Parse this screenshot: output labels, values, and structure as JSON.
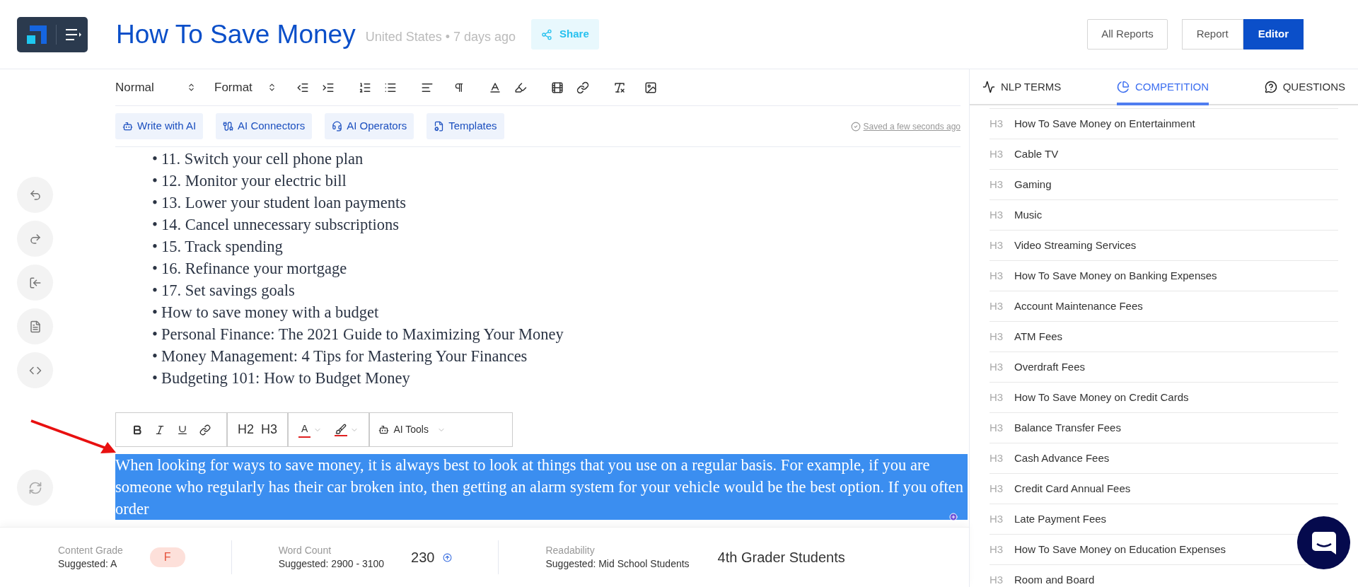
{
  "header": {
    "title": "How To Save Money",
    "location": "United States",
    "separator": "•",
    "age": "7 days ago",
    "share": "Share"
  },
  "nav_buttons": [
    {
      "label": "All Reports"
    }
  ],
  "view_toggle": [
    {
      "label": "Report",
      "selected": false
    },
    {
      "label": "Editor",
      "selected": true
    }
  ],
  "toolbar": {
    "style_select": "Normal",
    "format_select": "Format"
  },
  "ai_buttons": [
    "Write with AI",
    "AI Connectors",
    "AI Operators",
    "Templates"
  ],
  "save_status": "Saved a few seconds ago",
  "content": {
    "bullet": "•",
    "list": [
      "11. Switch your cell phone plan",
      "12. Monitor your electric bill",
      "13. Lower your student loan payments",
      "14. Cancel unnecessary subscriptions",
      "15. Track spending",
      "16. Refinance your mortgage",
      "17. Set savings goals",
      "How to save money with a budget",
      "Personal Finance: The 2021 Guide to Maximizing Your Money",
      "Money Management: 4 Tips for Mastering Your Finances",
      "Budgeting 101: How to Budget Money"
    ],
    "selected_paragraph": "When looking for ways to save money, it is always best to look at things that you use on a regular basis. For example, if you are someone who regularly has their car broken into, then getting an alarm system for your vehicle would be the best option. If you often order"
  },
  "bubble_toolbar": {
    "headings": [
      "H2",
      "H3"
    ],
    "text_color": "A",
    "ai_tools": "AI Tools"
  },
  "tabs": [
    {
      "label": "NLP TERMS",
      "selected": false
    },
    {
      "label": "COMPETITION",
      "selected": true
    },
    {
      "label": "QUESTIONS",
      "selected": false
    }
  ],
  "headings": [
    {
      "level": "H3",
      "text": "How To Save Money on Entertainment"
    },
    {
      "level": "H3",
      "text": "Cable TV"
    },
    {
      "level": "H3",
      "text": "Gaming"
    },
    {
      "level": "H3",
      "text": "Music"
    },
    {
      "level": "H3",
      "text": "Video Streaming Services"
    },
    {
      "level": "H3",
      "text": "How To Save Money on Banking Expenses"
    },
    {
      "level": "H3",
      "text": "Account Maintenance Fees"
    },
    {
      "level": "H3",
      "text": "ATM Fees"
    },
    {
      "level": "H3",
      "text": "Overdraft Fees"
    },
    {
      "level": "H3",
      "text": "How To Save Money on Credit Cards"
    },
    {
      "level": "H3",
      "text": "Balance Transfer Fees"
    },
    {
      "level": "H3",
      "text": "Cash Advance Fees"
    },
    {
      "level": "H3",
      "text": "Credit Card Annual Fees"
    },
    {
      "level": "H3",
      "text": "Late Payment Fees"
    },
    {
      "level": "H3",
      "text": "How To Save Money on Education Expenses"
    },
    {
      "level": "H3",
      "text": "Room and Board"
    }
  ],
  "metrics": [
    {
      "kind": "grade",
      "label": "Content Grade",
      "suggested": "Suggested: A",
      "value": "F"
    },
    {
      "kind": "count",
      "label": "Word Count",
      "suggested": "Suggested: 2900 - 3100",
      "value": "230"
    },
    {
      "kind": "text",
      "label": "Readability",
      "suggested": "Suggested: Mid School Students",
      "value": "4th Grader Students"
    }
  ]
}
